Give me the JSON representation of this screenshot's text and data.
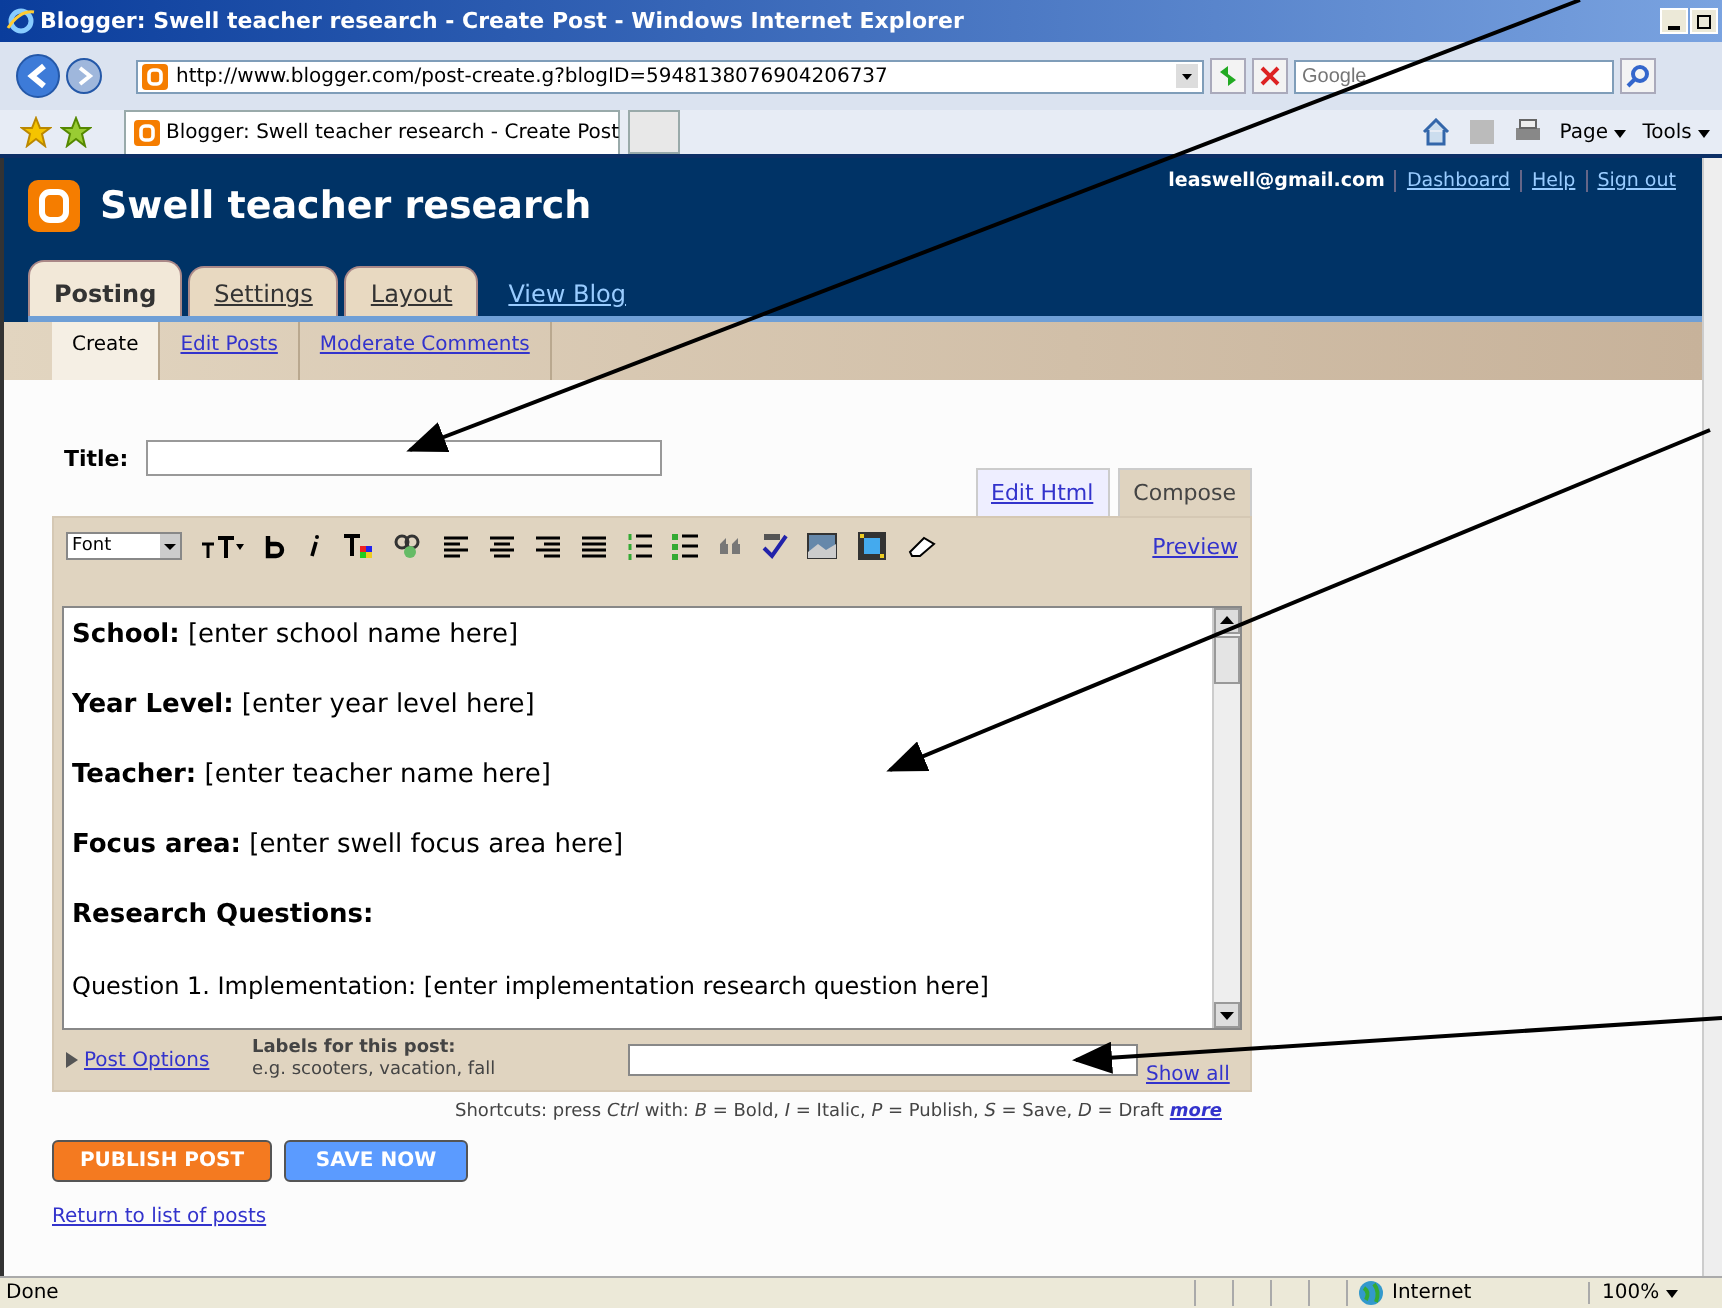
{
  "window": {
    "title": "Blogger: Swell teacher research - Create Post - Windows Internet Explorer"
  },
  "address_bar": {
    "url": "http://www.blogger.com/post-create.g?blogID=5948138076904206737"
  },
  "search": {
    "placeholder": "Google"
  },
  "browser_tabs": [
    {
      "label": "Blogger: Swell teacher research - Create Post",
      "selected": true
    }
  ],
  "command_bar": {
    "page": "Page",
    "tools": "Tools"
  },
  "blog": {
    "title": "Swell teacher research",
    "user": "leaswell@gmail.com",
    "links": [
      "Dashboard",
      "Help",
      "Sign out"
    ]
  },
  "tabs": [
    {
      "label": "Posting",
      "selected": true,
      "kind": "tab"
    },
    {
      "label": "Settings",
      "selected": false,
      "kind": "tab"
    },
    {
      "label": "Layout",
      "selected": false,
      "kind": "tab"
    },
    {
      "label": "View Blog",
      "selected": false,
      "kind": "link"
    }
  ],
  "subtabs": [
    {
      "label": "Create",
      "selected": true
    },
    {
      "label": "Edit Posts",
      "selected": false
    },
    {
      "label": "Moderate Comments",
      "selected": false
    }
  ],
  "title_field": {
    "label": "Title:"
  },
  "editor_modes": [
    {
      "label": "Edit Html",
      "selected": false
    },
    {
      "label": "Compose",
      "selected": true
    }
  ],
  "toolbar": {
    "font": "Font",
    "preview": "Preview"
  },
  "editor_lines": [
    {
      "kind": "field",
      "label": "School:",
      "value": "[enter school name here]"
    },
    {
      "kind": "field",
      "label": "Year Level:",
      "value": "[enter year level here]"
    },
    {
      "kind": "field",
      "label": "Teacher:",
      "value": "[enter teacher name here]"
    },
    {
      "kind": "field",
      "label": "Focus area:",
      "value": "[enter swell focus area here]"
    },
    {
      "kind": "heading",
      "text": "Research Questions:"
    },
    {
      "kind": "plain",
      "text": "Question 1. Implementation: [enter implementation research question here]"
    }
  ],
  "post_options": {
    "link": "Post Options",
    "labels_title": "Labels for this post:",
    "labels_hint": "e.g. scooters, vacation, fall",
    "show_all": "Show all"
  },
  "shortcuts": "Shortcuts: press *Ctrl* with: *B* = Bold, *I* = Italic, *P* = Publish, *S* = Save, *D* = Draft",
  "shortcuts_more": "more",
  "buttons": [
    {
      "label": "PUBLISH POST",
      "kind": "primary"
    },
    {
      "label": "SAVE NOW",
      "kind": "secondary"
    }
  ],
  "return_link": "Return to list of posts",
  "status_bar": {
    "text": "Done",
    "zone": "Internet",
    "zoom": "100%"
  }
}
